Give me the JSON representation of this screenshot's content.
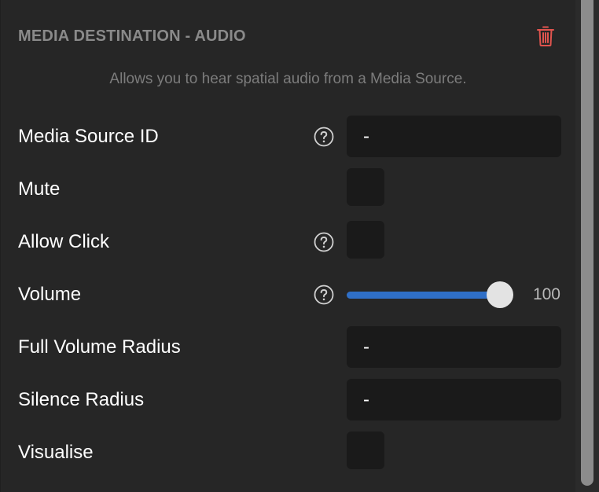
{
  "header": {
    "title": "MEDIA DESTINATION - AUDIO",
    "delete_icon": "trash-icon",
    "delete_color": "#e0544e"
  },
  "description": "Allows you to hear spatial audio from a Media Source.",
  "fields": {
    "media_source_id": {
      "label": "Media Source ID",
      "value": "-",
      "help_icon": "question-circle-icon"
    },
    "mute": {
      "label": "Mute",
      "checked": false
    },
    "allow_click": {
      "label": "Allow Click",
      "checked": false,
      "help_icon": "question-circle-icon"
    },
    "volume": {
      "label": "Volume",
      "value": "100",
      "level_percent": 100,
      "help_icon": "question-circle-icon",
      "accent": "#2f6fc7"
    },
    "full_volume_radius": {
      "label": "Full Volume Radius",
      "value": "-"
    },
    "silence_radius": {
      "label": "Silence Radius",
      "value": "-"
    },
    "visualise": {
      "label": "Visualise",
      "checked": false
    }
  }
}
